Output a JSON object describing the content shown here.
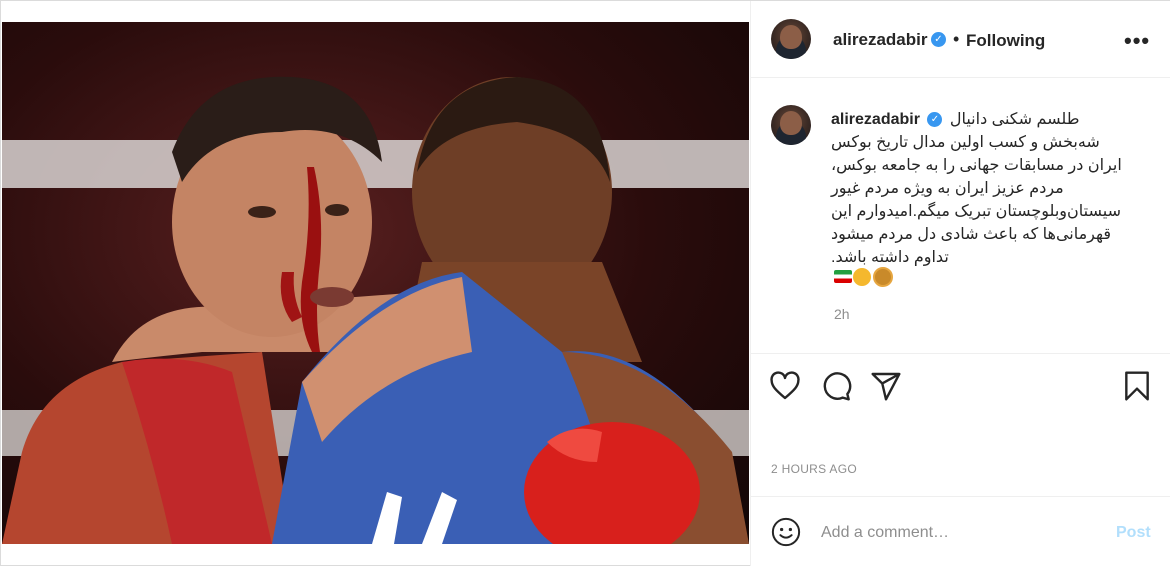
{
  "post": {
    "username": "alirezadabir",
    "separator": "•",
    "follow_status": "Following",
    "more_label": "•••"
  },
  "caption": {
    "username": "alirezadabir",
    "lines": [
      "طلسم شکنی دانیال",
      "شه‌بخش و کسب اولین مدال تاریخ بوکس",
      "ایران در مسابقات جهانی را به جامعه بوکس،",
      "مردم عزیز ایران به ویژه مردم غیور",
      "سیستان‌وبلوچستان تبریک میگم.امیدوارم این",
      "قهرمانی‌ها که باعث شادی دل مردم میشود",
      "تداوم داشته باشد."
    ],
    "emoji_names": [
      "iran-flag",
      "clapping-hands",
      "medal"
    ],
    "relative_time": "2h"
  },
  "actions": {
    "icons": [
      "heart-icon",
      "comment-icon",
      "share-icon",
      "bookmark-icon"
    ]
  },
  "timestamp": "2 HOURS AGO",
  "comment": {
    "placeholder": "Add a comment…",
    "post_label": "Post",
    "icon": "emoji-icon"
  },
  "colors": {
    "verified": "#3897f0",
    "post_disabled": "#b2dffc",
    "muted_text": "#8e8e8e",
    "red_gear": "#c0282a",
    "blue_gear": "#3a5fb5"
  }
}
